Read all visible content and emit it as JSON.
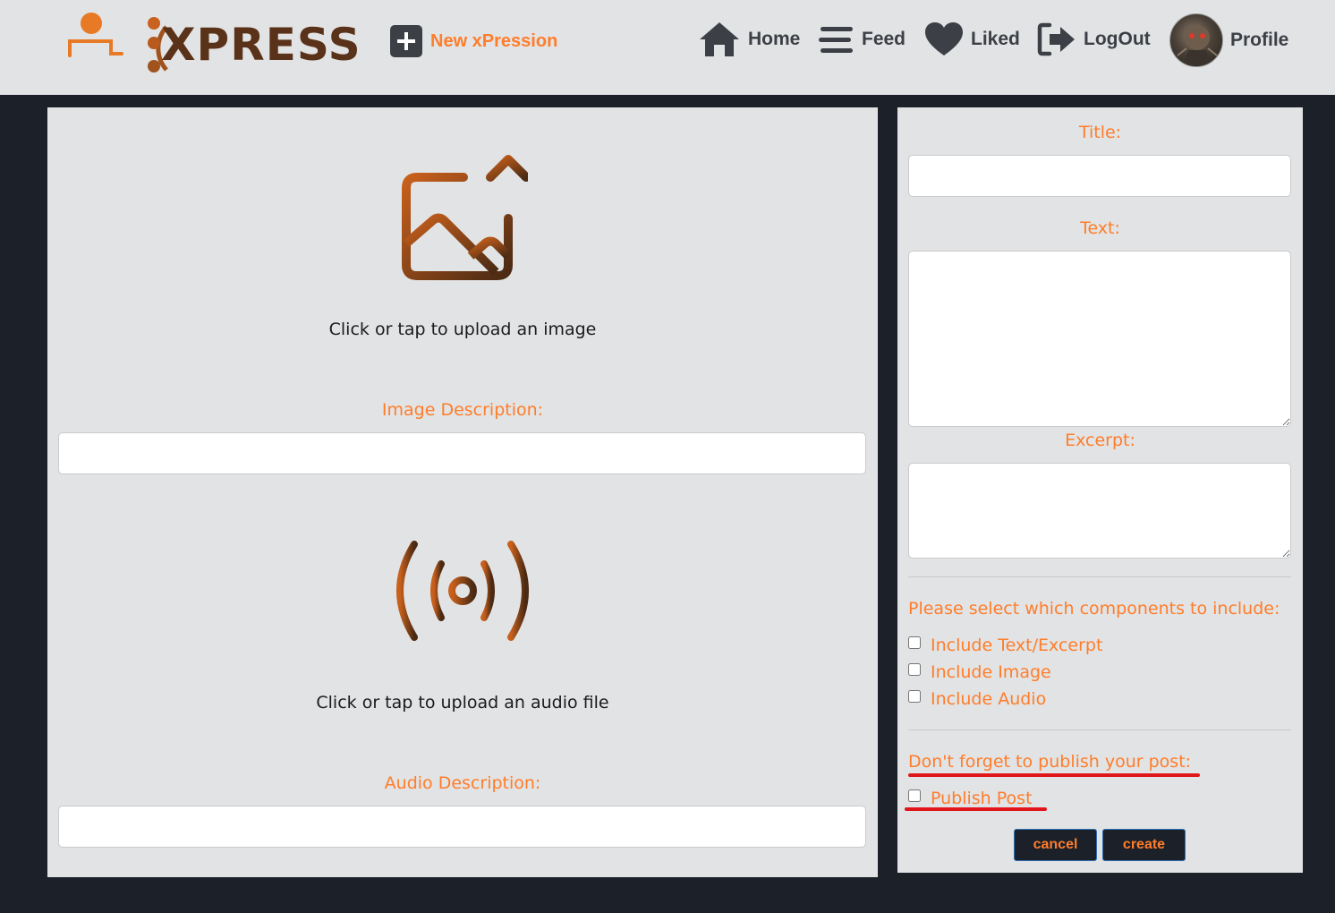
{
  "brand": {
    "logo_text": "XPRESS",
    "accent": "#ff7d2b",
    "brown": "#5a3219"
  },
  "header": {
    "new_button": {
      "label": "New xPression",
      "icon": "plus-square-icon"
    },
    "nav": [
      {
        "label": "Home",
        "icon": "home-icon"
      },
      {
        "label": "Feed",
        "icon": "bars-icon"
      },
      {
        "label": "Liked",
        "icon": "heart-icon"
      },
      {
        "label": "LogOut",
        "icon": "logout-icon"
      },
      {
        "label": "Profile",
        "icon": "avatar"
      }
    ]
  },
  "left": {
    "image_upload": {
      "caption": "Click or tap to upload an image",
      "icon": "image-upload-icon"
    },
    "image_description": {
      "label": "Image Description:",
      "value": ""
    },
    "audio_upload": {
      "caption": "Click or tap to upload an audio file",
      "icon": "broadcast-icon"
    },
    "audio_description": {
      "label": "Audio Description:",
      "value": ""
    }
  },
  "right": {
    "title": {
      "label": "Title:",
      "value": ""
    },
    "text": {
      "label": "Text:",
      "value": ""
    },
    "excerpt": {
      "label": "Excerpt:",
      "value": ""
    },
    "components_prompt": "Please select which components to include:",
    "components": [
      {
        "label": "Include Text/Excerpt",
        "checked": false
      },
      {
        "label": "Include Image",
        "checked": false
      },
      {
        "label": "Include Audio",
        "checked": false
      }
    ],
    "publish_prompt": "Don't forget to publish your post:",
    "publish": {
      "label": "Publish Post",
      "checked": false
    },
    "buttons": {
      "cancel": "cancel",
      "create": "create"
    }
  }
}
